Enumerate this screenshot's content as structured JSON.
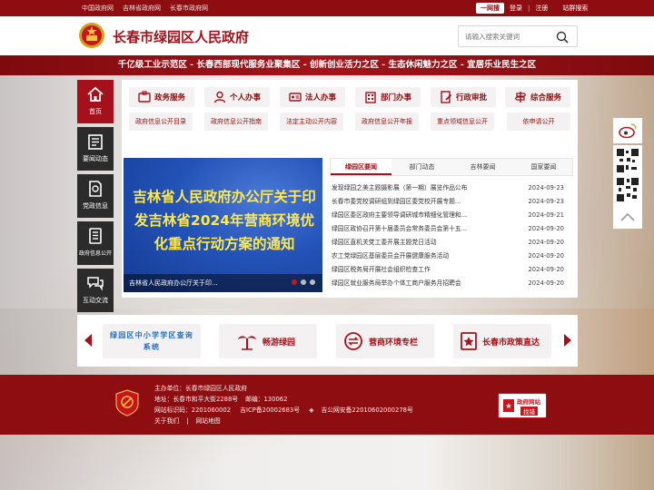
{
  "topbar": {
    "links": [
      "中国政府网",
      "吉林省政府网",
      "长春市政府网"
    ],
    "accessible_label": "一网搜",
    "login": "登录",
    "register": "注册",
    "site_group": "站群搜索"
  },
  "header": {
    "title": "长春市绿园区人民政府",
    "search_placeholder": "请输入搜索关键词"
  },
  "slogan": "千亿级工业示范区 - 长春西部现代服务业聚集区 - 创新创业活力之区 - 生态休闲魅力之区 - 宜居乐业民生之区",
  "leftnav": [
    {
      "label": "首页",
      "icon": "home-icon"
    },
    {
      "label": "要闻动态",
      "icon": "news-icon"
    },
    {
      "label": "党政信息",
      "icon": "document-icon"
    },
    {
      "label": "政府信息公开",
      "icon": "info-public-icon"
    },
    {
      "label": "互动交流",
      "icon": "chat-icon"
    }
  ],
  "services": [
    {
      "label": "政务服务",
      "icon": "service-icon"
    },
    {
      "label": "个人办事",
      "icon": "person-icon"
    },
    {
      "label": "法人办事",
      "icon": "id-card-icon"
    },
    {
      "label": "部门办事",
      "icon": "building-icon"
    },
    {
      "label": "行政审批",
      "icon": "approval-icon"
    },
    {
      "label": "综合服务",
      "icon": "signpost-icon"
    }
  ],
  "info_links": [
    "政府信息公开目录",
    "政府信息公开指南",
    "法定主动公开内容",
    "政府信息公开年报",
    "重点领域信息公开",
    "依申请公开"
  ],
  "carousel": {
    "headline": "吉林省人民政府办公厅关于印发吉林省2024年营商环境优化重点行动方案的通知",
    "caption": "吉林省人民政府办公厅关于印..."
  },
  "news": {
    "tabs": [
      "绿园区要闻",
      "部门动态",
      "吉林要闻",
      "国家要闻"
    ],
    "items": [
      {
        "title": "发现绿园之美主题摄影展（第一期）展览作品公布",
        "date": "2024-09-23"
      },
      {
        "title": "长春市委党校调研组到绿园区委党校开展专题...",
        "date": "2024-09-23"
      },
      {
        "title": "绿园区委区政府主要领导调研城市精细化管理和...",
        "date": "2024-09-21"
      },
      {
        "title": "绿园区政协召开第十届委员会常务委员会第十五...",
        "date": "2024-09-20"
      },
      {
        "title": "绿园区直机关党工委开展主题党日活动",
        "date": "2024-09-20"
      },
      {
        "title": "农工党绿园区基层委员会开展健康服务活动",
        "date": "2024-09-20"
      },
      {
        "title": "绿园区税务局开展社会组织检查工作",
        "date": "2024-09-20"
      },
      {
        "title": "绿园区就业服务局举办个体工商户服务月招聘会",
        "date": "2024-09-20"
      }
    ]
  },
  "quick_links": {
    "schools": "绿园区中小学学区查询系统",
    "tour": "畅游绿园",
    "business": "营商环境专栏",
    "policy": "长春市政策直达"
  },
  "footer": {
    "sponsor": "主办单位：长春市绿园区人民政府",
    "address": "地址：长春市和平大街2288号",
    "postcode": "邮编：130062",
    "site_id": "网站标识码：2201060002",
    "icp": "吉ICP备20002683号",
    "police": "吉公网安备22010602000278号",
    "about": "关于我们",
    "sitemap": "网站地图",
    "badge_top": "政府网站",
    "badge_bottom": "找错"
  },
  "colors": {
    "brand_red": "#a5111a",
    "dark_red": "#8e0d10",
    "nav_dark": "#2b2b2b"
  }
}
